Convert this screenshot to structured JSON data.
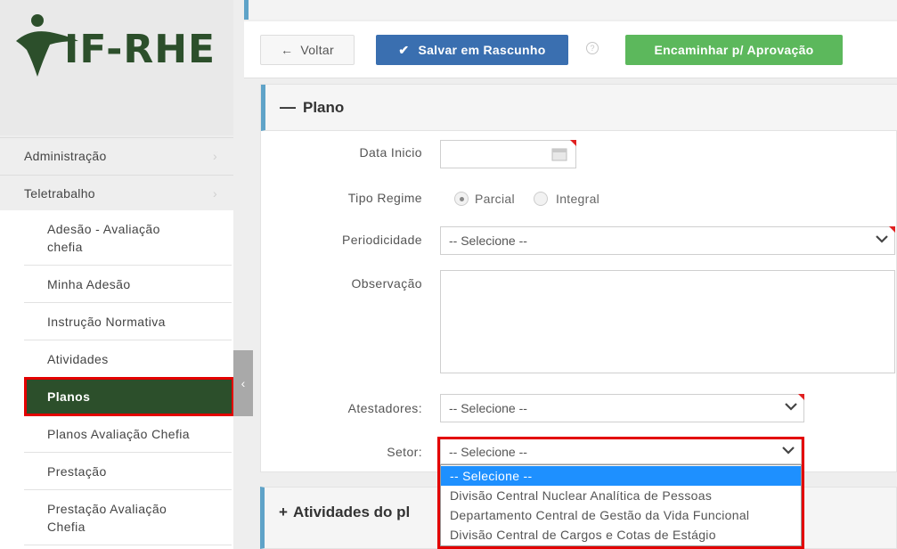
{
  "app": {
    "logo_text": "IF-RHE"
  },
  "sidebar": {
    "top_items": [
      {
        "label": "Administração"
      },
      {
        "label": "Teletrabalho"
      }
    ],
    "sub_items": [
      {
        "label": "Adesão - Avaliação chefia"
      },
      {
        "label": "Minha Adesão"
      },
      {
        "label": "Instrução Normativa"
      },
      {
        "label": "Atividades"
      },
      {
        "label": "Planos",
        "active": true
      },
      {
        "label": "Planos Avaliação Chefia"
      },
      {
        "label": "Prestação"
      },
      {
        "label": "Prestação Avaliação Chefia"
      }
    ]
  },
  "toolbar": {
    "back_label": "Voltar",
    "save_draft_label": "Salvar em Rascunho",
    "forward_label": "Encaminhar p/ Aprovação"
  },
  "plano": {
    "title": "Plano",
    "data_inicio_label": "Data Inicio",
    "data_inicio_value": "",
    "tipo_regime_label": "Tipo Regime",
    "tipo_regime_options": [
      "Parcial",
      "Integral"
    ],
    "tipo_regime_selected": "Parcial",
    "periodicidade_label": "Periodicidade",
    "periodicidade_value": "-- Selecione --",
    "observacao_label": "Observação",
    "observacao_value": "",
    "atestadores_label": "Atestadores:",
    "atestadores_value": "-- Selecione --",
    "setor_label": "Setor:",
    "setor_value": "-- Selecione --",
    "setor_options": [
      "-- Selecione --",
      "Divisão Central Nuclear Analítica de Pessoas",
      "Departamento Central de Gestão da Vida Funcional",
      "Divisão Central de Cargos e Cotas de Estágio"
    ]
  },
  "atividades_panel": {
    "title": "Atividades do pl"
  },
  "colors": {
    "brand_green": "#2c4f2b",
    "save_blue": "#3a6fb0",
    "forward_green": "#5cb85c",
    "panel_accent": "#5fa3c8",
    "highlight_red": "#e30000",
    "option_selected": "#1e90ff"
  }
}
